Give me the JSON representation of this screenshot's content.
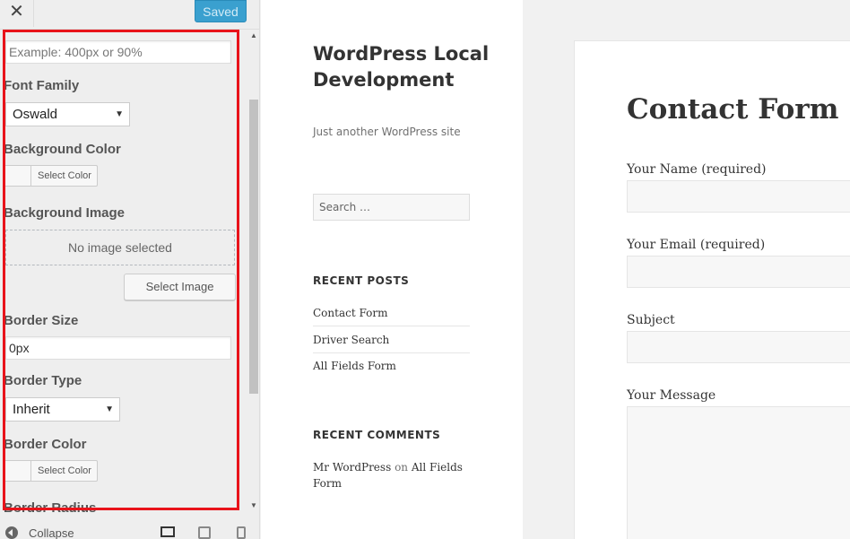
{
  "customizer": {
    "close_icon_glyph": "✕",
    "save_button_label": "Saved",
    "fields": {
      "width_placeholder": "Example: 400px or 90%",
      "font_family_label": "Font Family",
      "font_family_value": "Oswald",
      "background_color_label": "Background Color",
      "background_color_button": "Select Color",
      "background_image_label": "Background Image",
      "no_image_text": "No image selected",
      "select_image_button": "Select Image",
      "border_size_label": "Border Size",
      "border_size_value": "0px",
      "border_type_label": "Border Type",
      "border_type_value": "Inherit",
      "border_color_label": "Border Color",
      "border_color_button": "Select Color",
      "border_radius_label": "Border Radius"
    },
    "footer": {
      "collapse_label": "Collapse"
    }
  },
  "preview": {
    "site_title": "WordPress Local Development",
    "tagline": "Just another WordPress site",
    "search_placeholder": "Search …",
    "recent_posts_title": "RECENT POSTS",
    "recent_posts": [
      "Contact Form",
      "Driver Search",
      "All Fields Form"
    ],
    "recent_comments_title": "RECENT COMMENTS",
    "comment": {
      "author": "Mr WordPress",
      "connector": "on",
      "post": "All Fields Form"
    },
    "page_title": "Contact Form",
    "form_fields": [
      "Your Name (required)",
      "Your Email (required)",
      "Subject",
      "Your Message"
    ]
  },
  "colors": {
    "highlight": "#e8131a",
    "save_button": "#3aa0cf"
  }
}
